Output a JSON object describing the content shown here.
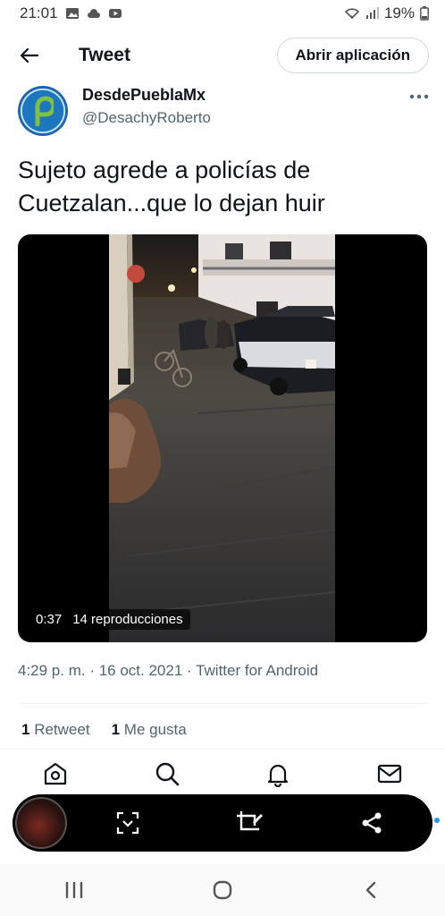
{
  "status_bar": {
    "time": "21:01",
    "battery": "19%",
    "icons": [
      "gallery-icon",
      "cloud-icon",
      "youtube-icon",
      "wifi-icon",
      "signal-icon",
      "battery-icon"
    ]
  },
  "header": {
    "title": "Tweet",
    "open_app_label": "Abrir aplicación"
  },
  "tweet": {
    "display_name": "DesdePueblaMx",
    "handle": "@DesachyRoberto",
    "text": "Sujeto agrede a policías de Cuetzalan...que lo dejan huir",
    "video": {
      "duration": "0:37",
      "views": "14 reproducciones"
    },
    "timestamp": "4:29 p. m. · 16 oct. 2021 · Twitter for Android",
    "retweets_count": "1",
    "retweets_label": "Retweet",
    "likes_count": "1",
    "likes_label": "Me gusta"
  },
  "tab_bar": [
    "home-icon",
    "search-icon",
    "notifications-icon",
    "messages-icon"
  ],
  "screenshot_toolbar": [
    "scan-icon",
    "crop-edit-icon",
    "share-icon"
  ],
  "nav_bar": [
    "recents-icon",
    "home-circle-icon",
    "back-chevron-icon"
  ],
  "colors": {
    "text_primary": "#0f1419",
    "text_secondary": "#536471",
    "accent": "#1d9bf0"
  }
}
